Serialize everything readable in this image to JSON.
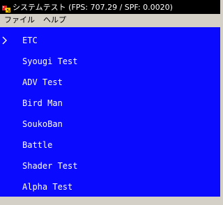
{
  "window": {
    "title": "システムテスト (FPS: 707.29 / SPF: 0.0020)",
    "app_icon": "dice-icon",
    "colors": {
      "title_bg": "#000000",
      "title_text": "#ffffff",
      "chrome": "#d4d0c8",
      "client_bg": "#0a0aff",
      "client_text": "#ffffff"
    }
  },
  "menubar": {
    "items": [
      {
        "label": "ファイル"
      },
      {
        "label": "ヘルプ"
      }
    ]
  },
  "test_menu": {
    "selected_index": 0,
    "cursor_icon": "chevron-right-icon",
    "items": [
      {
        "label": "ETC"
      },
      {
        "label": "Syougi Test"
      },
      {
        "label": "ADV Test"
      },
      {
        "label": "Bird Man"
      },
      {
        "label": "SoukoBan"
      },
      {
        "label": "Battle"
      },
      {
        "label": "Shader Test"
      },
      {
        "label": "Alpha Test"
      }
    ]
  }
}
